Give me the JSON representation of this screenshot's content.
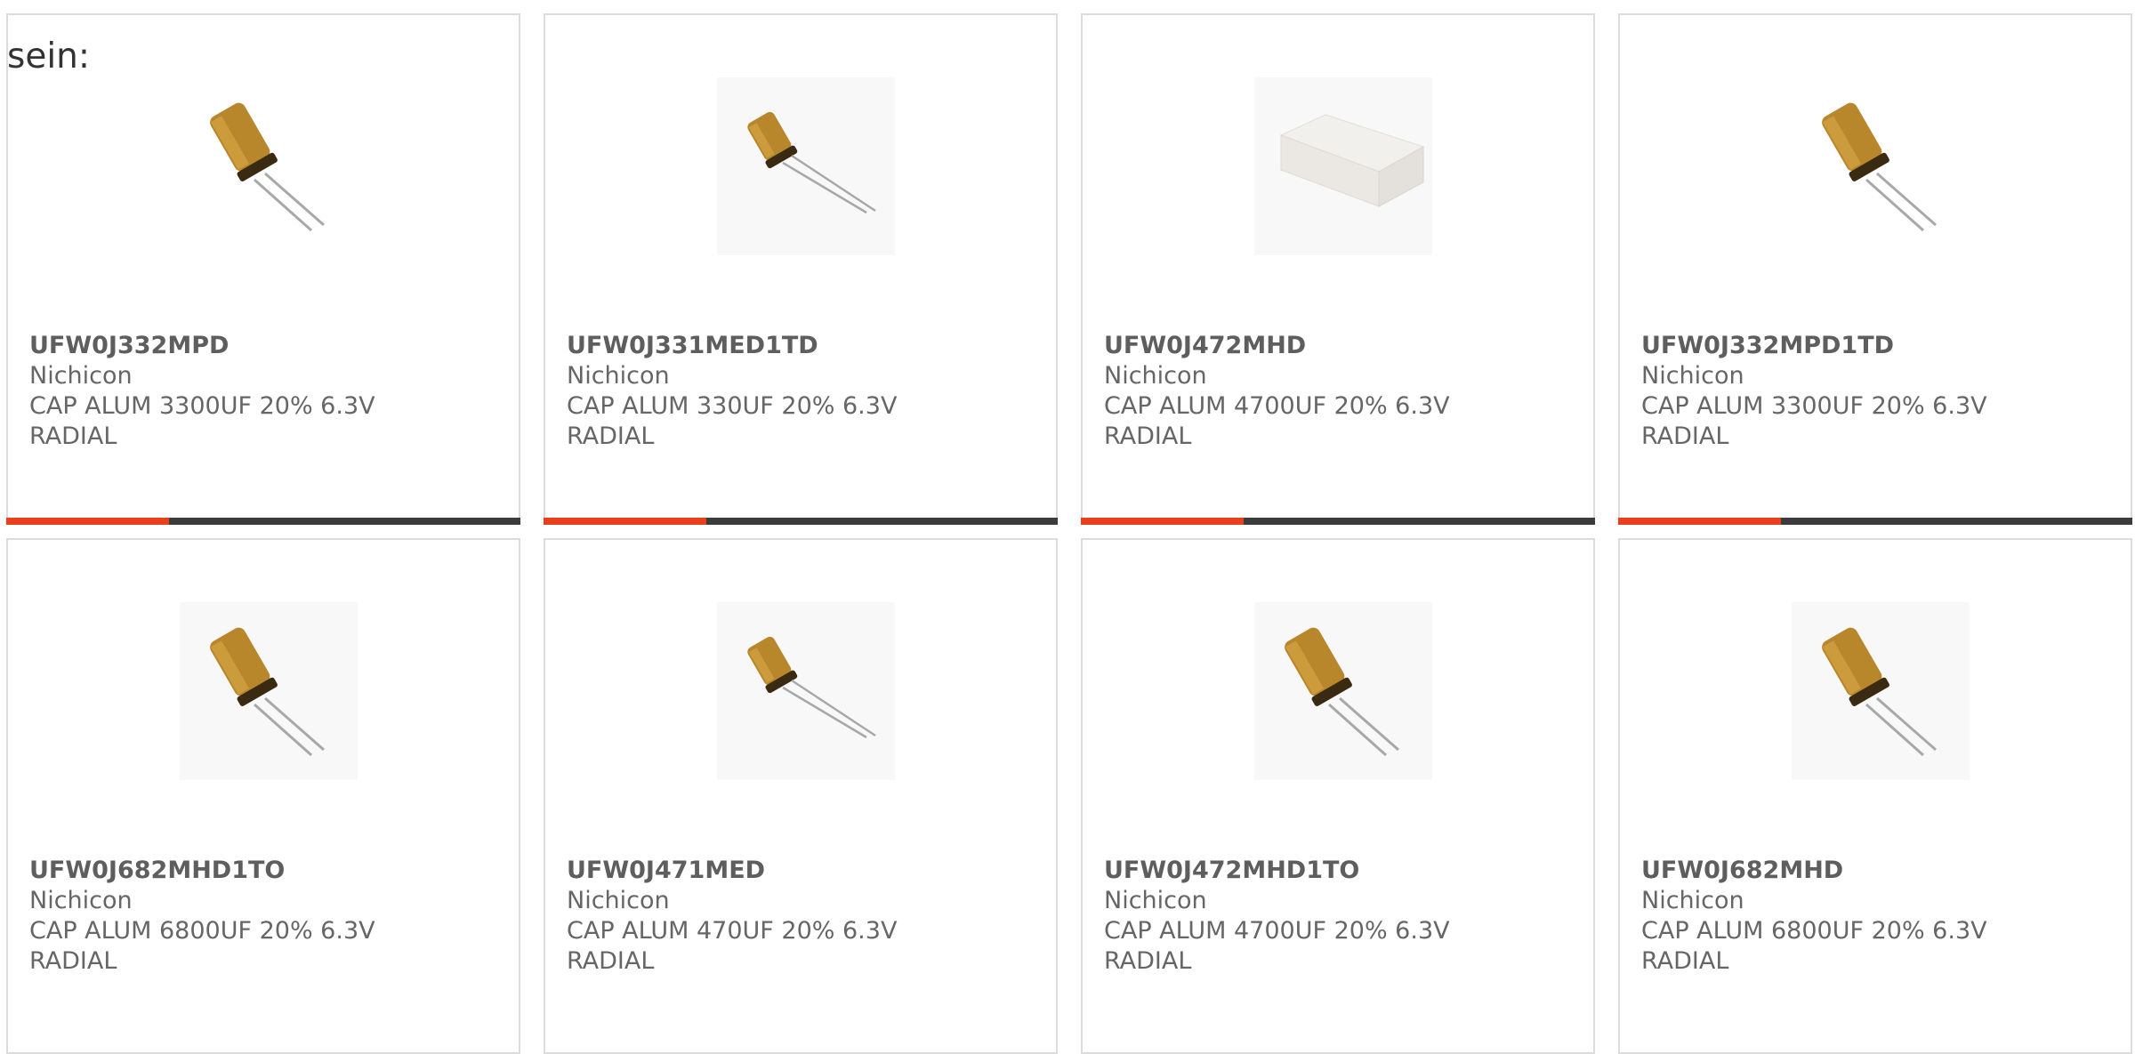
{
  "intro_text": "sein:",
  "accent_color": "#e8401c",
  "bar_color": "#3b3b3b",
  "products": [
    {
      "part": "UFW0J332MPD",
      "maker": "Nichicon",
      "desc": "CAP ALUM 3300UF 20% 6.3V",
      "pkg": "RADIAL",
      "image": "capacitor-gold"
    },
    {
      "part": "UFW0J331MED1TD",
      "maker": "Nichicon",
      "desc": "CAP ALUM 330UF 20% 6.3V",
      "pkg": "RADIAL",
      "image": "capacitor-gold-small"
    },
    {
      "part": "UFW0J472MHD",
      "maker": "Nichicon",
      "desc": "CAP ALUM 4700UF 20% 6.3V",
      "pkg": "RADIAL",
      "image": "white-block"
    },
    {
      "part": "UFW0J332MPD1TD",
      "maker": "Nichicon",
      "desc": "CAP ALUM 3300UF 20% 6.3V",
      "pkg": "RADIAL",
      "image": "capacitor-gold"
    },
    {
      "part": "UFW0J682MHD1TO",
      "maker": "Nichicon",
      "desc": "CAP ALUM 6800UF 20% 6.3V",
      "pkg": "RADIAL",
      "image": "capacitor-gold"
    },
    {
      "part": "UFW0J471MED",
      "maker": "Nichicon",
      "desc": "CAP ALUM 470UF 20% 6.3V",
      "pkg": "RADIAL",
      "image": "capacitor-gold-small"
    },
    {
      "part": "UFW0J472MHD1TO",
      "maker": "Nichicon",
      "desc": "CAP ALUM 4700UF 20% 6.3V",
      "pkg": "RADIAL",
      "image": "capacitor-gold"
    },
    {
      "part": "UFW0J682MHD",
      "maker": "Nichicon",
      "desc": "CAP ALUM 6800UF 20% 6.3V",
      "pkg": "RADIAL",
      "image": "capacitor-gold"
    }
  ]
}
